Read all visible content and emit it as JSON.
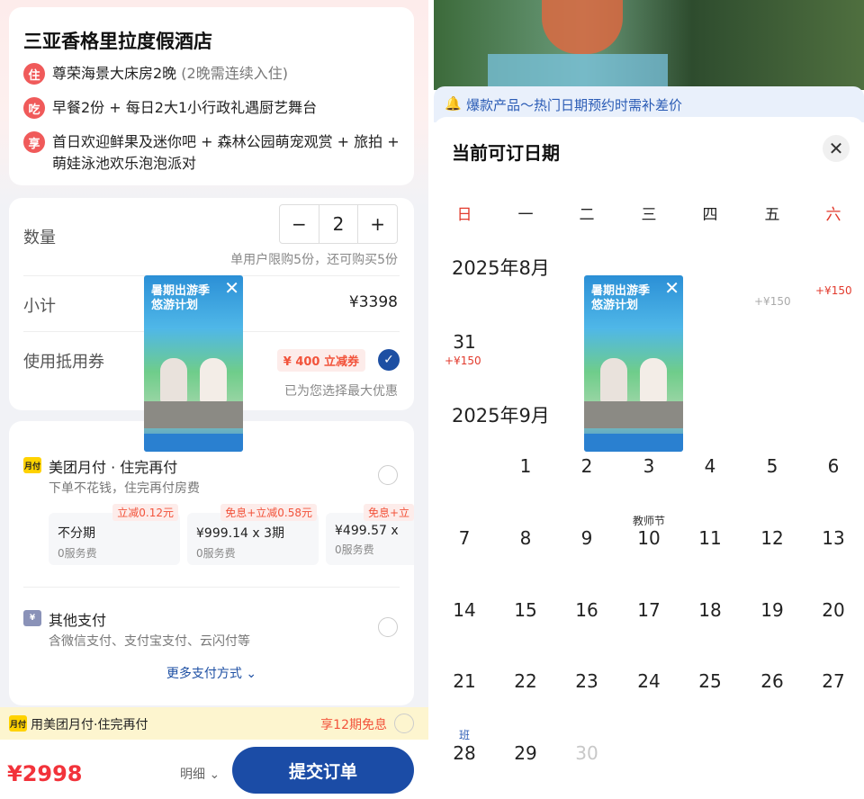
{
  "left": {
    "hotel": {
      "name": "三亚香格里拉度假酒店",
      "items": [
        {
          "icon": "住",
          "text": "尊荣海景大床房2晚",
          "note": "(2晚需连续入住)"
        },
        {
          "icon": "吃",
          "text": "早餐2份 + 每日2大1小行政礼遇厨艺舞台"
        },
        {
          "icon": "享",
          "text": "首日欢迎鲜果及迷你吧 + 森林公园萌宠观赏 + 旅拍 + 萌娃泳池欢乐泡泡派对"
        }
      ]
    },
    "quantity": {
      "label": "数量",
      "minus": "−",
      "value": "2",
      "plus": "+",
      "limit_hint": "单用户限购5份，还可购买5份"
    },
    "subtotal": {
      "label": "小计",
      "value": "¥3398"
    },
    "coupon": {
      "label": "使用抵用券",
      "tag": "¥ 400 立减券",
      "hint": "已为您选择最大优惠"
    },
    "payment": {
      "meituan": {
        "logo": "月付",
        "title": "美团月付 · 住完再付",
        "subtitle": "下单不花钱，住完再付房费",
        "options": [
          {
            "main": "不分期",
            "fee": "0服务费",
            "tag": "立减0.12元"
          },
          {
            "main": "¥999.14 x 3期",
            "fee": "0服务费",
            "tag": "免息+立减0.58元"
          },
          {
            "main": "¥499.57 x",
            "fee": "0服务费",
            "tag": "免息+立"
          }
        ]
      },
      "other": {
        "logo": "¥",
        "title": "其他支付",
        "subtitle": "含微信支付、支付宝支付、云闪付等"
      },
      "more": "更多支付方式"
    },
    "promo": {
      "logo": "月付",
      "text": "用美团月付·住完再付",
      "right": "享12期免息"
    },
    "bottom": {
      "price": "¥2998",
      "detail": "明细",
      "submit": "提交订单"
    }
  },
  "popup": {
    "title": "暑期出游季 悠游计划"
  },
  "right": {
    "notice": "爆款产品～热门日期预约时需补差价",
    "title": "当前可订日期",
    "weekdays": [
      "日",
      "一",
      "二",
      "三",
      "四",
      "五",
      "六"
    ],
    "aug": {
      "month": "2025年8月",
      "day31": "31",
      "day31_price": "+¥150",
      "partial_price_1": "+¥150",
      "partial_price_2": "+¥150"
    },
    "sep": {
      "month": "2025年9月",
      "holiday_label": "教师节",
      "work_label": "班",
      "rows": [
        [
          "",
          "1",
          "2",
          "3",
          "4",
          "5",
          "6"
        ],
        [
          "7",
          "8",
          "9",
          "10",
          "11",
          "12",
          "13"
        ],
        [
          "14",
          "15",
          "16",
          "17",
          "18",
          "19",
          "20"
        ],
        [
          "21",
          "22",
          "23",
          "24",
          "25",
          "26",
          "27"
        ],
        [
          "28",
          "29",
          "30",
          "",
          "",
          "",
          ""
        ]
      ]
    }
  },
  "colors": {
    "accent": "#1b4ca6",
    "red": "#f2333b",
    "icon_red": "#f05a5a"
  }
}
